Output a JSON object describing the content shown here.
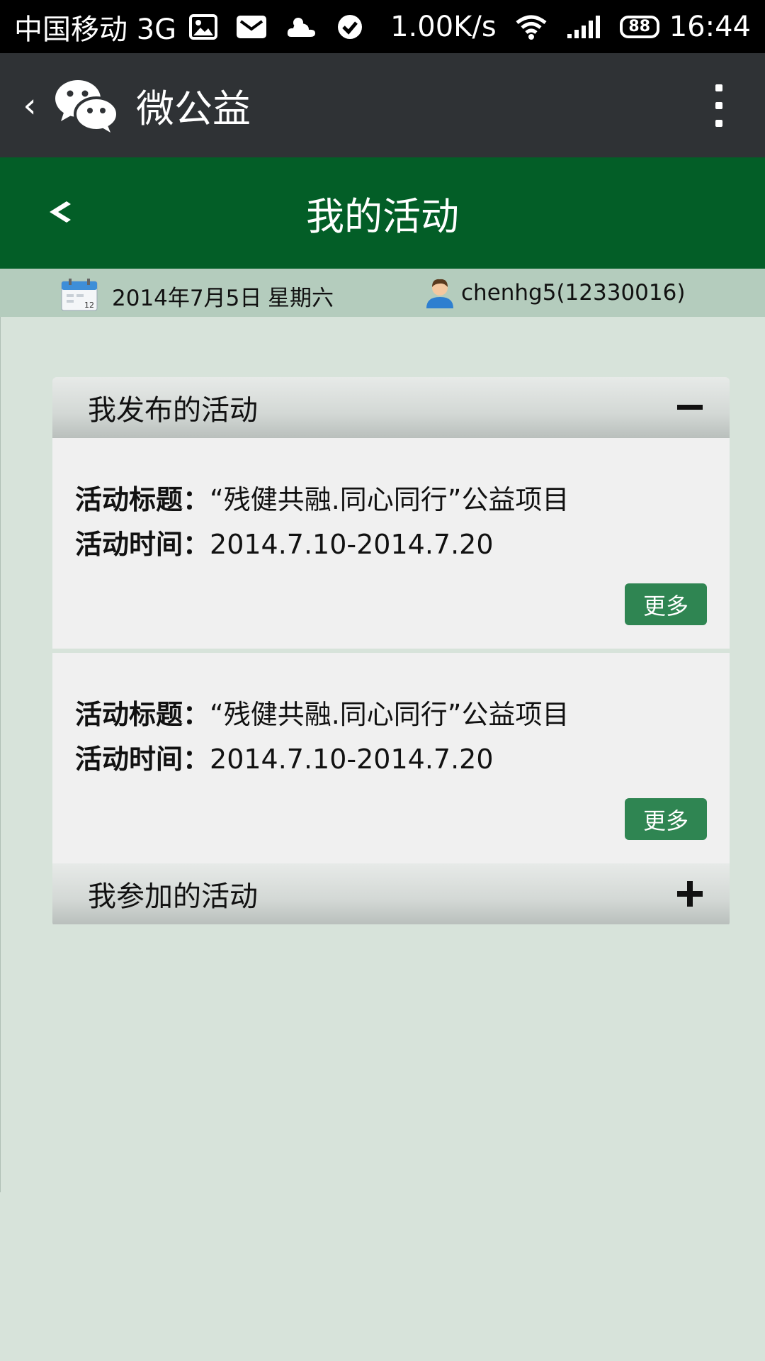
{
  "status_bar": {
    "carrier": "中国移动 3G",
    "speed": "1.00K/s",
    "battery": "88",
    "time": "16:44"
  },
  "wx_header": {
    "back": "‹",
    "title": "微公益"
  },
  "title_bar": {
    "title": "我的活动"
  },
  "info_bar": {
    "date": "2014年7月5日",
    "weekday": "星期六",
    "user": "chenhg5(12330016)"
  },
  "sections": [
    {
      "title": "我发布的活动",
      "expanded": true,
      "items": [
        {
          "title_label": "活动标题：",
          "title_value": "“残健共融.同心同行”公益项目",
          "time_label": "活动时间：",
          "time_value": "2014.7.10-2014.7.20",
          "more_label": "更多"
        },
        {
          "title_label": "活动标题：",
          "title_value": "“残健共融.同心同行”公益项目",
          "time_label": "活动时间：",
          "time_value": "2014.7.10-2014.7.20",
          "more_label": "更多"
        }
      ]
    },
    {
      "title": "我参加的活动",
      "expanded": false
    }
  ],
  "colors": {
    "status_bar": "#000000",
    "wx_header": "#2f3235",
    "title_bar": "#035e27",
    "info_bar": "#b4ccbd",
    "background": "#d7e3da",
    "more_button": "#2f8552"
  }
}
